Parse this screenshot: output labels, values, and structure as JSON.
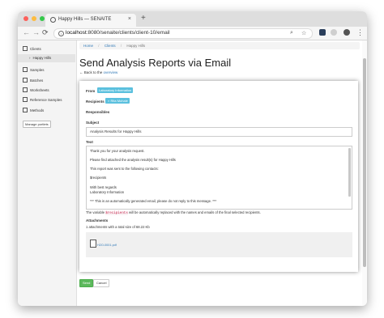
{
  "browser": {
    "tab_title": "Happy Hills — SENAITE",
    "tab_close": "×",
    "new_tab": "+",
    "nav_back": "←",
    "nav_forward": "→",
    "nav_reload": "⟳",
    "url_host": "localhost",
    "url_rest": ":8080/senaite/clients/client-10/email",
    "zoom_glyph": "⌕",
    "star_glyph": "☆",
    "menu_glyph": "⋮",
    "colors": {
      "close": "#fc605b",
      "minimize": "#fdbc40",
      "maximize": "#34c84a"
    }
  },
  "sidebar": {
    "items": [
      {
        "label": "Clients",
        "icon": "clients-icon"
      },
      {
        "label": "Happy Hills",
        "icon": "chevron-right-icon"
      },
      {
        "label": "Samples",
        "icon": "samples-icon"
      },
      {
        "label": "Batches",
        "icon": "batches-icon"
      },
      {
        "label": "Worksheets",
        "icon": "worksheets-icon"
      },
      {
        "label": "Reference Samples",
        "icon": "reference-icon"
      },
      {
        "label": "Methods",
        "icon": "methods-icon"
      }
    ],
    "chevron": "›",
    "manage_label": "Manage portlets"
  },
  "breadcrumb": {
    "home": "Home",
    "sep": "/",
    "clients": "Clients",
    "current": "Happy Hills"
  },
  "page": {
    "title": "Send Analysis Reports via Email",
    "back_prefix": "← Back to the",
    "back_link": "overview"
  },
  "form": {
    "from_label": "From",
    "from_value": "Laboratory Information",
    "recipients_label": "Recipients",
    "recipient_value": "Rita Mohale",
    "recipient_remove": "×",
    "responsibles_label": "Responsibles",
    "subject_label": "Subject",
    "subject_value": "Analysis Results for Happy Hills",
    "text_label": "Text",
    "text_lines": [
      "Thank you for your analysis request.",
      "Please find attached the analysis result(s) for Happy Hills",
      "This report was sent to the following contacts:",
      "$recipients",
      "With best regards",
      "Laboratory Information",
      "*** This is an automatically generated email, please do not reply to this message. ***"
    ],
    "hint_prefix": "The variable",
    "hint_var": "$recipients",
    "hint_suffix": "will be automatically replaced with the names and emails of the final selected recipients.",
    "attachments_label": "Attachments",
    "attachments_summary": "1 attachments with a total size of 68.22 Kb",
    "attachment_file": "H2O-0001.pdf",
    "send_label": "Send",
    "cancel_label": "Cancel",
    "colors": {
      "badge": "#5bc0de",
      "send": "#5cb85c",
      "link": "#337ab7"
    }
  }
}
